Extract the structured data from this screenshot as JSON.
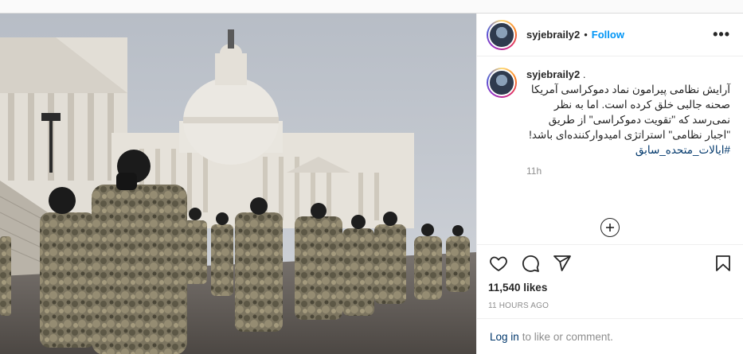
{
  "post": {
    "author": {
      "username": "syjebraily2",
      "follow_label": "Follow",
      "separator": "•"
    },
    "caption": {
      "username": "syjebraily2",
      "suffix": ".",
      "text": "آرایش نظامی پیرامون نماد دموکراسی آمریکا صحنه جالبی خلق کرده است. اما به نظر نمی‌رسد که \"تقویت دموکراسی\" از طریق \"اجبار نظامی\" استراتژی امیدوارکننده‌ای باشد!",
      "hashtag": "#ایالات_متحده_سابق",
      "time": "11h"
    },
    "likes": "11,540 likes",
    "posted": "11 HOURS AGO",
    "login": {
      "link": "Log in",
      "text": "to like or comment."
    },
    "more_label": "•••"
  },
  "icons": {
    "more": "more-options-icon",
    "load_more": "plus-circle-icon",
    "like": "heart-icon",
    "comment": "comment-icon",
    "share": "share-icon",
    "save": "bookmark-icon"
  },
  "colors": {
    "accent": "#0095f6",
    "link": "#00376b",
    "muted": "#8e8e8e",
    "text": "#262626"
  }
}
